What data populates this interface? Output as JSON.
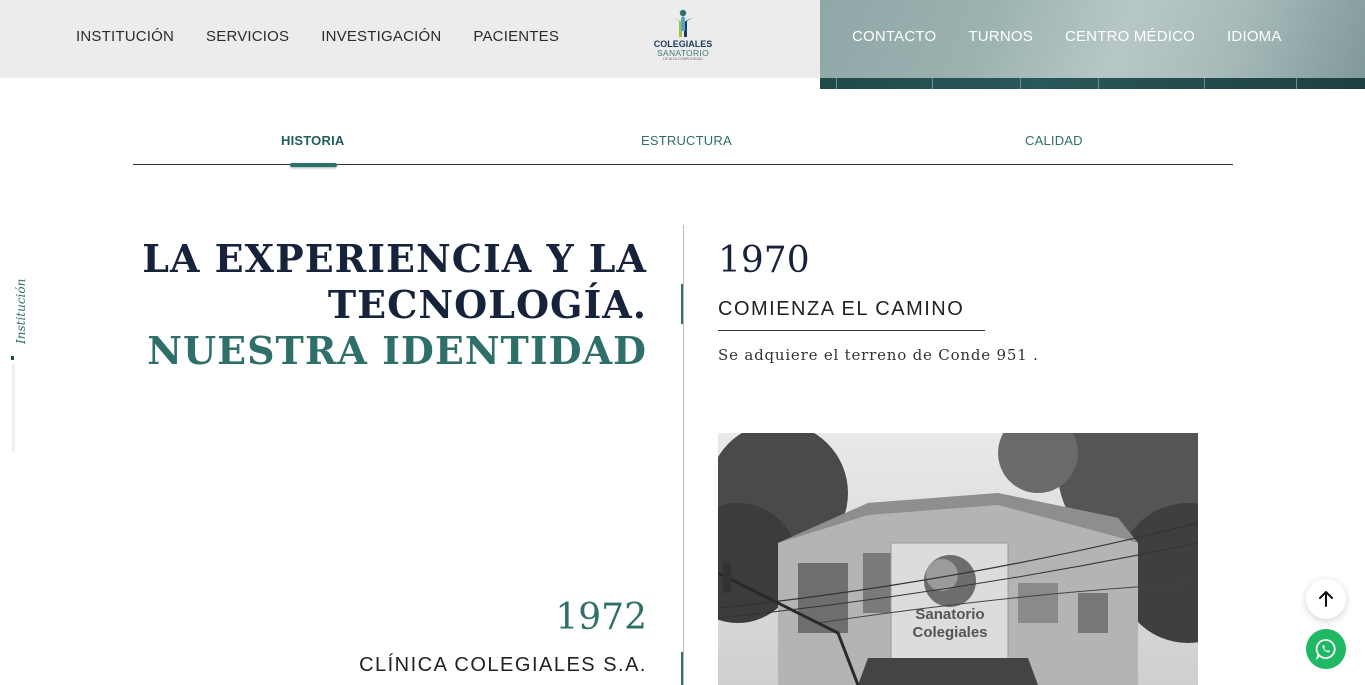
{
  "header": {
    "nav_left": [
      "INSTITUCIÓN",
      "SERVICIOS",
      "INVESTIGACIÓN",
      "PACIENTES"
    ],
    "nav_right": [
      "CONTACTO",
      "TURNOS",
      "CENTRO MÉDICO",
      "IDIOMA"
    ],
    "logo": {
      "line1": "COLEGIALES",
      "line2": "SANATORIO",
      "line3": "DE ALTA COMPLEJIDAD"
    }
  },
  "tabs": {
    "items": [
      "HISTORIA",
      "ESTRUCTURA",
      "CALIDAD"
    ],
    "active": "HISTORIA"
  },
  "side_label": "Institución",
  "identity": {
    "line1": "LA EXPERIENCIA Y LA",
    "line2": "TECNOLOGÍA.",
    "line3": "NUESTRA IDENTIDAD"
  },
  "timeline": [
    {
      "year": "1970",
      "title": "COMIENZA EL CAMINO",
      "text": "Se adquiere el terreno de Conde 951 ."
    },
    {
      "year": "1972",
      "title": "CLÍNICA COLEGIALES S.A."
    }
  ],
  "photo": {
    "sign_line1": "Sanatorio",
    "sign_line2": "Colegiales"
  },
  "icons": {
    "scroll_top": "arrow-up-icon",
    "whatsapp": "whatsapp-icon"
  },
  "colors": {
    "accent": "#2e6f6a",
    "navy": "#17233a",
    "whatsapp": "#1fb865"
  }
}
